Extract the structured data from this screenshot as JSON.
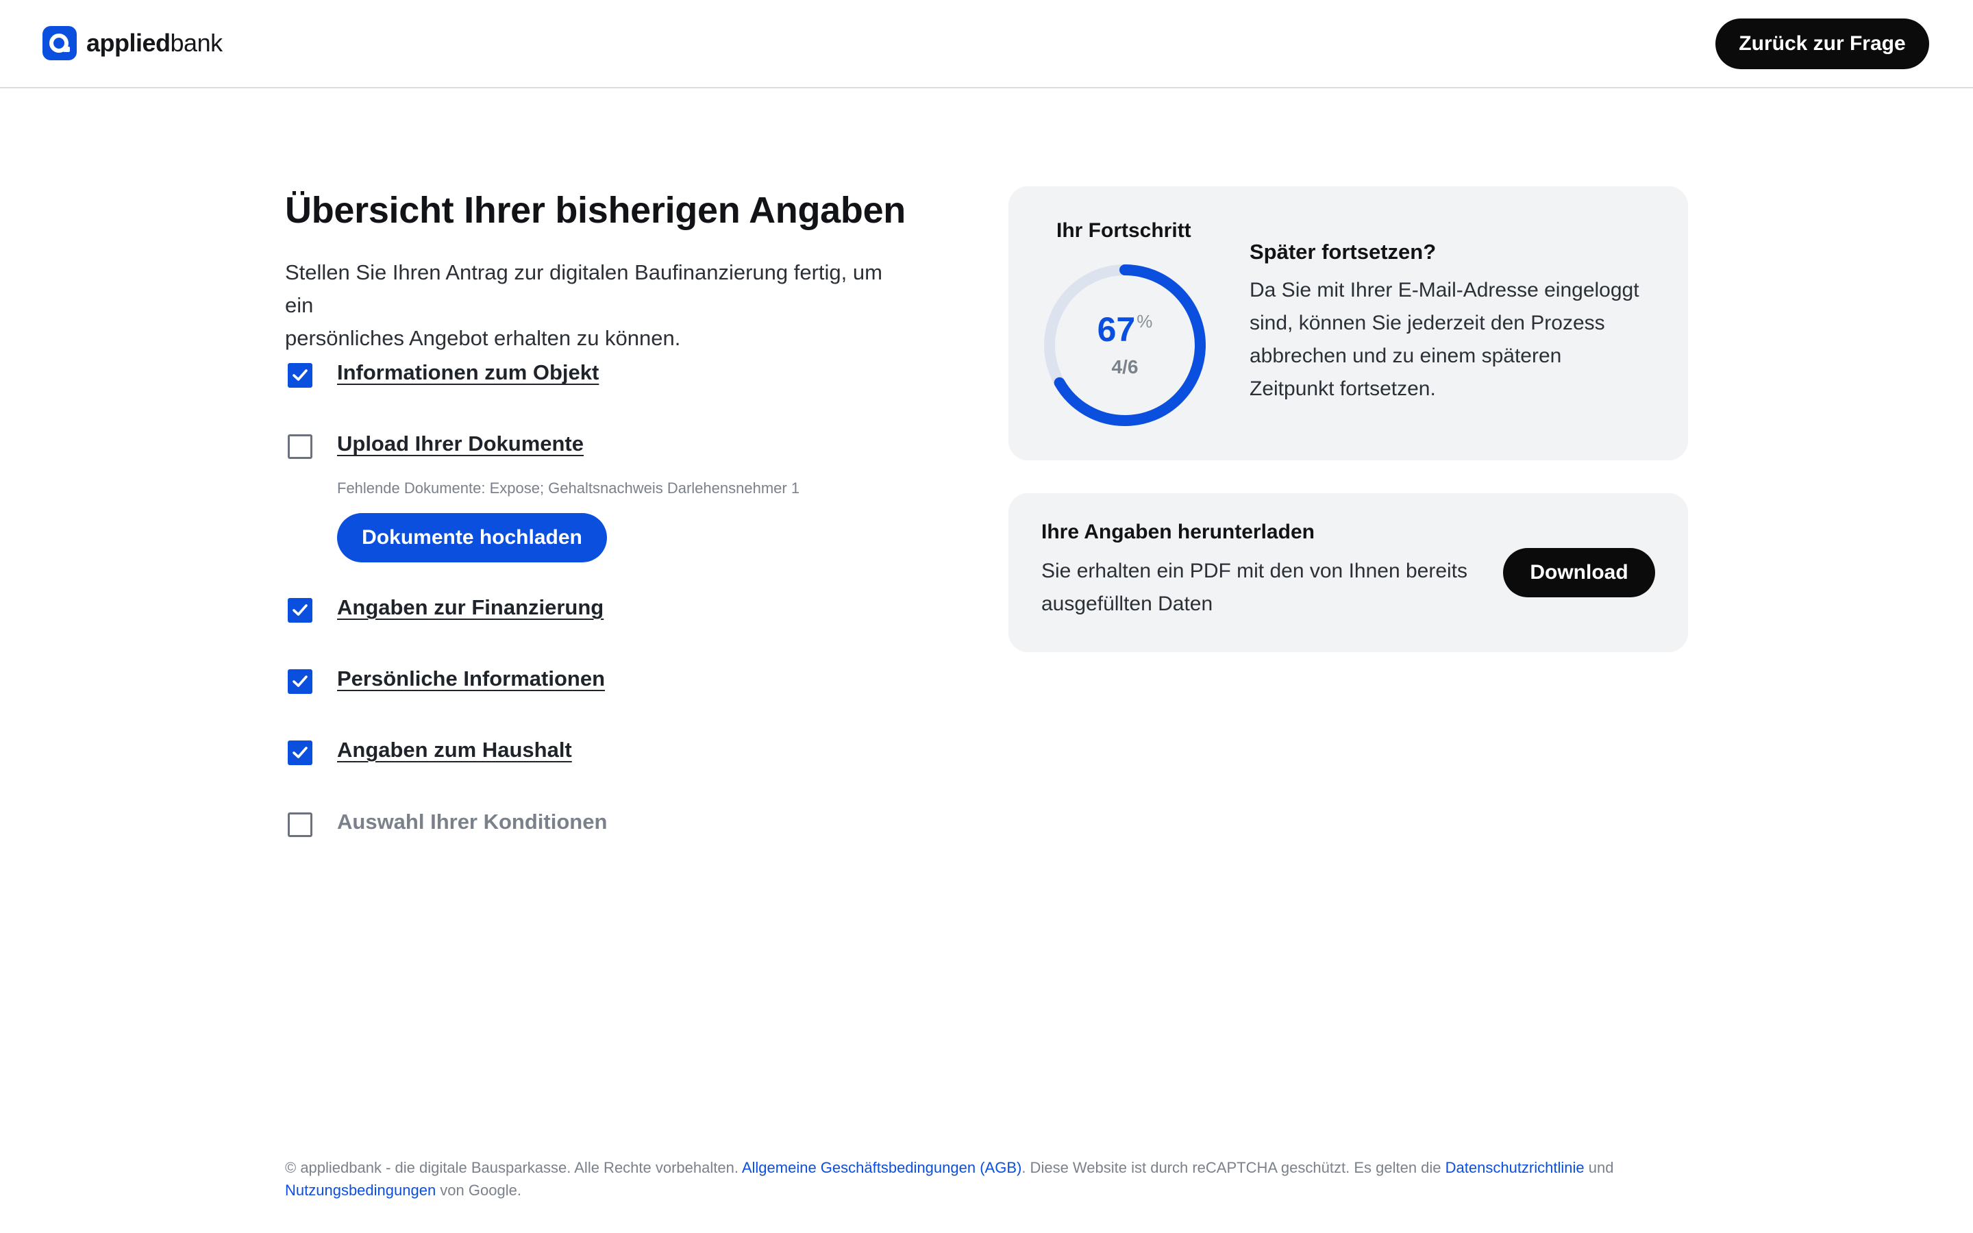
{
  "header": {
    "logo_bold": "applied",
    "logo_regular": "bank",
    "back_button": "Zurück zur Frage"
  },
  "main": {
    "title": "Übersicht Ihrer bisherigen Angaben",
    "intro_line1": "Stellen Sie Ihren Antrag zur digitalen Baufinanzierung fertig, um ein",
    "intro_line2": "persönliches Angebot erhalten zu können.",
    "steps": [
      {
        "label": "Informationen zum Objekt",
        "checked": true
      },
      {
        "label": "Upload Ihrer Dokumente",
        "checked": false,
        "missing": "Fehlende Dokumente: Expose; Gehaltsnachweis Darlehensnehmer 1",
        "button": "Dokumente hochladen"
      },
      {
        "label": "Angaben zur Finanzierung",
        "checked": true
      },
      {
        "label": "Persönliche Informationen",
        "checked": true
      },
      {
        "label": "Angaben zum Haushalt",
        "checked": true
      },
      {
        "label": "Auswahl Ihrer Konditionen",
        "checked": false
      }
    ]
  },
  "progress": {
    "label": "Ihr Fortschritt",
    "percent": "67",
    "percent_sign": "%",
    "fraction": "4/6",
    "completed": 4,
    "total": 6,
    "later_title": "Später fortsetzen?",
    "later_line1": "Da Sie mit Ihrer E-Mail-Adresse eingeloggt",
    "later_line2": "sind, können Sie jederzeit den Prozess",
    "later_line3": "abbrechen und zu einem späteren",
    "later_line4": "Zeitpunkt fortsetzen."
  },
  "download": {
    "title": "Ihre Angaben herunterladen",
    "text_line1": "Sie erhalten ein PDF mit den von Ihnen bereits",
    "text_line2": "ausgefüllten Daten",
    "button": "Download"
  },
  "footer": {
    "text1": "© appliedbank - die digitale Bausparkasse. Alle Rechte vorbehalten. ",
    "link_agb": "Allgemeine Geschäftsbedingungen (AGB)",
    "text2": ". Diese Website ist durch reCAPTCHA geschützt. Es gelten die ",
    "link_privacy": "Datenschutzrichtlinie",
    "text3": " und",
    "link_terms": "Nutzungsbedingungen",
    "text4": " von Google."
  },
  "colors": {
    "accent": "#0b4fde",
    "dark_button": "#0b0b0c",
    "card_bg": "#f2f3f5",
    "donut_track": "#dde3ee"
  },
  "icons": {
    "logo": "applied-bank-logo-icon",
    "check": "checkmark-icon"
  }
}
